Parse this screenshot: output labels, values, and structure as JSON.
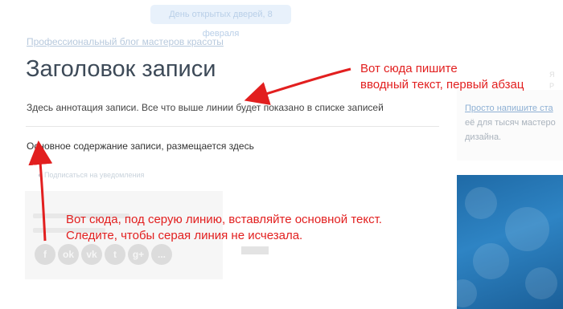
{
  "header": {
    "badge": "День открытых дверей, 8 февраля"
  },
  "post": {
    "blog_link": "Профессиональный блог мастеров красоты",
    "title": "Заголовок записи",
    "annotation": "Здесь аннотация записи. Все что выше линии будет показано в списке записей",
    "content": "Основное содержание записи, размещается здесь",
    "notify": "Подписаться на уведомления"
  },
  "share": {
    "icons": [
      "f",
      "ok",
      "vk",
      "t",
      "g+",
      "..."
    ]
  },
  "sidebar": {
    "line1": "Просто напишите ста",
    "line2": "её для тысяч мастеро",
    "line3": "дизайна.",
    "icon_text": "Я\nР"
  },
  "callouts": {
    "first_line1": "Вот сюда пишите",
    "first_line2": "вводный текст, первый абзац",
    "second_line1": "Вот сюда, под серую линию, вставляйте основной текст.",
    "second_line2": "Следите, чтобы серая линия не исчезала."
  },
  "colors": {
    "annotation_red": "#e21f1f",
    "title": "#3d4a58",
    "link": "#b7c9dd"
  }
}
